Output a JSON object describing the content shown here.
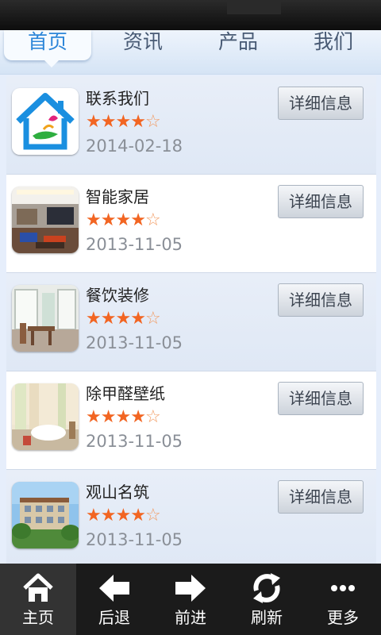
{
  "tabs": [
    {
      "label": "首页"
    },
    {
      "label": "资讯"
    },
    {
      "label": "产品"
    },
    {
      "label": "我们"
    }
  ],
  "list": {
    "items": [
      {
        "title": "联系我们",
        "rating": 4,
        "max_rating": 5,
        "date": "2014-02-18",
        "button": "详细信息",
        "image": "house-logo"
      },
      {
        "title": "智能家居",
        "rating": 4,
        "max_rating": 5,
        "date": "2013-11-05",
        "button": "详细信息",
        "image": "living-room-photo"
      },
      {
        "title": "餐饮装修",
        "rating": 4,
        "max_rating": 5,
        "date": "2013-11-05",
        "button": "详细信息",
        "image": "dining-room-photo"
      },
      {
        "title": "除甲醛壁纸",
        "rating": 4,
        "max_rating": 5,
        "date": "2013-11-05",
        "button": "详细信息",
        "image": "bedroom-photo"
      },
      {
        "title": "观山名筑",
        "rating": 4,
        "max_rating": 5,
        "date": "2013-11-05",
        "button": "详细信息",
        "image": "building-photo"
      }
    ]
  },
  "navbar": {
    "items": [
      {
        "label": "主页",
        "icon": "home-icon"
      },
      {
        "label": "后退",
        "icon": "back-arrow-icon"
      },
      {
        "label": "前进",
        "icon": "forward-arrow-icon"
      },
      {
        "label": "刷新",
        "icon": "refresh-icon"
      },
      {
        "label": "更多",
        "icon": "more-icon"
      }
    ]
  },
  "colors": {
    "accent": "#2d86d8",
    "star": "#f26522",
    "navbar_bg": "#1b1b1b"
  }
}
